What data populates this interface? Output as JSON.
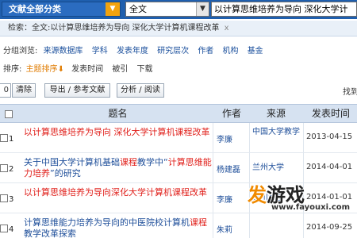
{
  "search": {
    "category": "文献全部分类",
    "field": "全文",
    "query": "以计算思维培养为导向 深化大学计"
  },
  "breadcrumb": {
    "prefix": "检索：",
    "path": "全文:以计算思维培养为导向 深化大学计算机课程改革",
    "close": "x"
  },
  "group_browse": {
    "label": "分组浏览:",
    "items": [
      "来源数据库",
      "学科",
      "发表年度",
      "研究层次",
      "作者",
      "机构",
      "基金"
    ]
  },
  "sort": {
    "label": "排序:",
    "active": "主题排序",
    "options": [
      "发表时间",
      "被引",
      "下载"
    ]
  },
  "toolbar": {
    "count": "0",
    "clear": "清除",
    "export": "导出 / 参考文献",
    "analyze": "分析 / 阅读",
    "right_text": "找到"
  },
  "table": {
    "headers": {
      "title": "题名",
      "author": "作者",
      "source": "来源",
      "date": "发表时间"
    },
    "rows": [
      {
        "num": "1",
        "title_parts": [
          "以计算思维培养为导向 深化大学计算机课程改革"
        ],
        "author": "李廉",
        "source": "中国大学教学",
        "date": "2013-04-15"
      },
      {
        "num": "2",
        "title_a": "关于中国大学计算机基础",
        "title_b": "课程",
        "title_c": "教学中“",
        "title_d": "计算思维能力培养",
        "title_e": "”的研究",
        "author": "杨建磊",
        "source": "兰州大学",
        "date": "2014-04-01"
      },
      {
        "num": "3",
        "title": "以计算思维培养为导向深化大学计算机课程改革",
        "author": "李廉",
        "source": "四川大学",
        "date": "2014-01-01"
      },
      {
        "num": "4",
        "title_a": "计算思维能力培养为导向的中医院校计算机",
        "title_b": "课程",
        "title_c": "教学改革探索",
        "author": "朱莉",
        "source": "",
        "date": "2014-09-25"
      }
    ]
  },
  "watermark": {
    "logo_a": "发",
    "logo_b": "游戏",
    "url": "www.fayouxi.com"
  }
}
